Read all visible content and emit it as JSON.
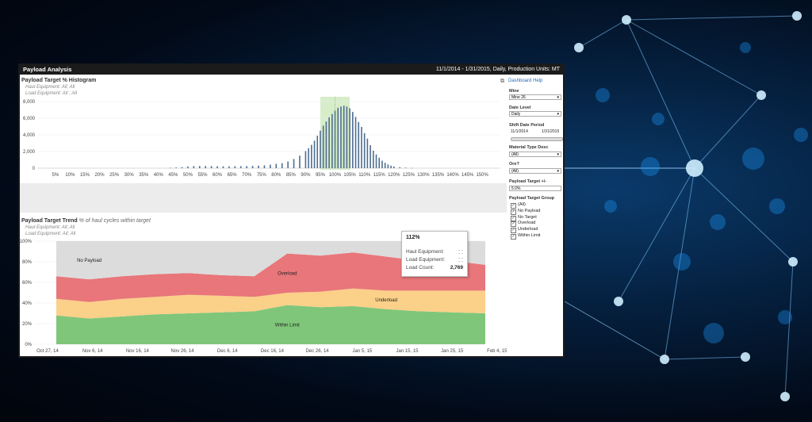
{
  "window": {
    "title": "Payload Analysis",
    "header_info": "11/1/2014 - 1/31/2015, Daily, Production Units: MT"
  },
  "dashboard_help": "Dashboard Help",
  "expand_icon": "expand-icon",
  "histogram": {
    "title": "Payload Target % Histogram",
    "filter_haul": "Haul Equipment: All; All",
    "filter_load": "Load Equipment: All ; All"
  },
  "trend": {
    "title": "Payload Target Trend",
    "subtitle": "% of haul cycles within target",
    "filter_haul": "Haul Equipment: All; All",
    "filter_load": "Load Equipment: All; All"
  },
  "tooltip": {
    "percent": "112%",
    "haul_label": "Haul Equipment:",
    "haul_value": "⁚ ⁚",
    "load_label": "Load Equipment:",
    "load_value": "⁚ ⁚",
    "count_label": "Load Count:",
    "count_value": "2,769"
  },
  "filters": {
    "mine_label": "Mine",
    "mine_value": "Mine 26",
    "date_level_label": "Date Level",
    "date_level_value": "Daily",
    "shift_label": "Shift Date Period",
    "shift_start": "11/1/2014",
    "shift_end": "1/31/2015",
    "material_label": "Material Type Desc",
    "material_value": "(All)",
    "ore_label": "Ore?",
    "ore_value": "(All)",
    "payload_label": "Payload Target +/-",
    "payload_value": "5.0%",
    "group_label": "Payload Target Group",
    "groups": [
      "(All)",
      "No Payload",
      "No Target",
      "Overload",
      "Underload",
      "Within Limit"
    ]
  },
  "colors": {
    "no_payload": "#dcdcdc",
    "overload": "#e8767a",
    "underload": "#fbd089",
    "within": "#80c67a",
    "bar": "#4e6e93",
    "highlight": "#d7edc9"
  },
  "chart_data": [
    {
      "type": "bar",
      "title": "Payload Target % Histogram",
      "yticks": [
        "0",
        "2,000",
        "4,000",
        "6,000",
        "8,000"
      ],
      "ylim": [
        0,
        8000
      ],
      "xticks": [
        "5%",
        "10%",
        "15%",
        "20%",
        "25%",
        "30%",
        "35%",
        "40%",
        "45%",
        "50%",
        "55%",
        "60%",
        "65%",
        "70%",
        "75%",
        "80%",
        "85%",
        "90%",
        "95%",
        "100%",
        "105%",
        "110%",
        "115%",
        "120%",
        "125%",
        "130%",
        "135%",
        "140%",
        "145%",
        "150%"
      ],
      "xlim": [
        1,
        154
      ],
      "x": [
        44,
        46,
        48,
        50,
        52,
        54,
        56,
        58,
        60,
        62,
        64,
        66,
        68,
        70,
        72,
        74,
        76,
        78,
        80,
        82,
        84,
        86,
        88,
        90,
        91,
        92,
        93,
        94,
        95,
        96,
        97,
        98,
        99,
        100,
        101,
        102,
        103,
        104,
        105,
        106,
        107,
        108,
        109,
        110,
        111,
        112,
        113,
        114,
        115,
        116,
        117,
        118,
        119,
        120,
        122,
        124,
        126
      ],
      "values": [
        40,
        80,
        120,
        200,
        250,
        260,
        260,
        250,
        230,
        220,
        220,
        230,
        240,
        250,
        270,
        300,
        340,
        420,
        520,
        600,
        800,
        1100,
        1500,
        2050,
        2400,
        2800,
        3300,
        3900,
        4500,
        5100,
        5600,
        6100,
        6500,
        6900,
        7250,
        7400,
        7500,
        7400,
        7200,
        6750,
        6150,
        5550,
        4950,
        4200,
        3550,
        2769,
        2100,
        1650,
        1250,
        900,
        650,
        450,
        300,
        200,
        110,
        60,
        30
      ],
      "highlight_range": [
        95,
        105
      ],
      "grid": true
    },
    {
      "type": "area",
      "title": "Payload Target Trend",
      "ylabel_ticks": [
        "0%",
        "20%",
        "40%",
        "60%",
        "80%",
        "100%"
      ],
      "ylim": [
        0,
        100
      ],
      "xticks": [
        "Oct 27, 14",
        "Nov 6, 14",
        "Nov 16, 14",
        "Nov 26, 14",
        "Dec 6, 14",
        "Dec 16, 14",
        "Dec 26, 14",
        "Jan 5, 15",
        "Jan 15, 15",
        "Jan 25, 15",
        "Feb 4, 15"
      ],
      "x": [
        "Nov 1",
        "Nov 8",
        "Nov 15",
        "Nov 22",
        "Nov 29",
        "Dec 6",
        "Dec 13",
        "Dec 20",
        "Dec 27",
        "Jan 3",
        "Jan 10",
        "Jan 17",
        "Jan 24",
        "Jan 31"
      ],
      "series": [
        {
          "name": "Within Limit",
          "values": [
            28,
            25,
            27,
            29,
            30,
            31,
            32,
            38,
            36,
            37,
            34,
            32,
            31,
            30
          ]
        },
        {
          "name": "Underload",
          "values": [
            16,
            16,
            17,
            17,
            18,
            16,
            14,
            12,
            15,
            17,
            18,
            20,
            21,
            22
          ]
        },
        {
          "name": "Overload",
          "values": [
            22,
            22,
            22,
            22,
            21,
            20,
            20,
            38,
            35,
            35,
            33,
            29,
            29,
            25
          ]
        },
        {
          "name": "No Payload",
          "values": [
            34,
            37,
            34,
            32,
            31,
            33,
            34,
            12,
            14,
            11,
            15,
            19,
            19,
            23
          ]
        }
      ],
      "grid": true
    }
  ]
}
